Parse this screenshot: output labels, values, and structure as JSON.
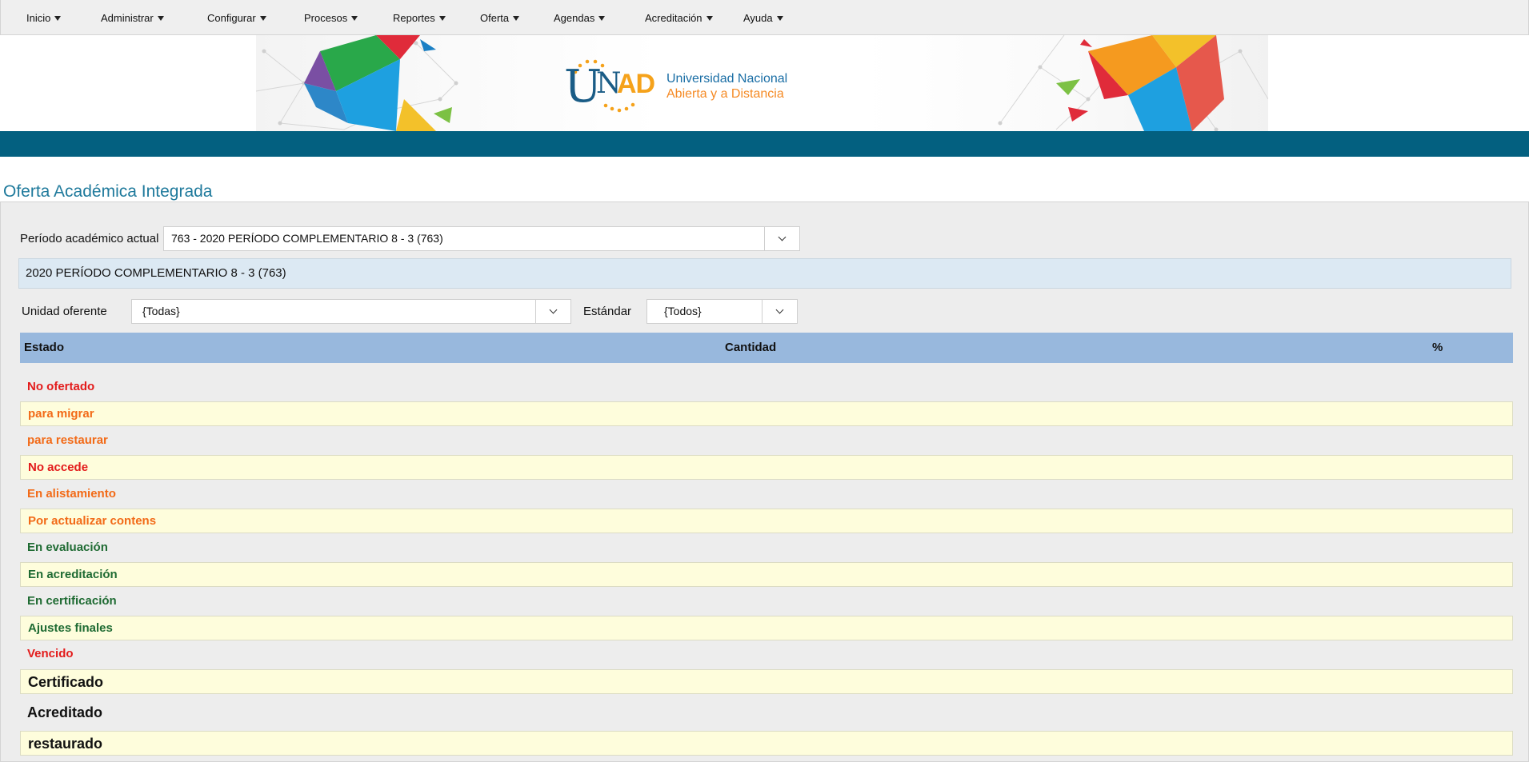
{
  "nav": {
    "items": [
      {
        "label": "Inicio"
      },
      {
        "label": "Administrar"
      },
      {
        "label": "Configurar"
      },
      {
        "label": "Procesos"
      },
      {
        "label": "Reportes"
      },
      {
        "label": "Oferta"
      },
      {
        "label": "Agendas"
      },
      {
        "label": "Acreditación"
      },
      {
        "label": "Ayuda"
      }
    ]
  },
  "banner": {
    "logo_letters_u": "U",
    "logo_letters_n": "N",
    "logo_letters_ad": "AD",
    "line1": "Universidad Nacional",
    "line2": "Abierta y a Distancia"
  },
  "page": {
    "title": "Oferta Académica Integrada"
  },
  "filters": {
    "periodo_label": "Período académico actual",
    "periodo_value": "763 - 2020 PERÍODO COMPLEMENTARIO 8 - 3 (763)",
    "periodo_info": "2020 PERÍODO COMPLEMENTARIO 8 - 3 (763)",
    "unidad_label": "Unidad oferente",
    "unidad_value": "{Todas}",
    "estandar_label": "Estándar",
    "estandar_value": "{Todos}"
  },
  "table": {
    "headers": {
      "estado": "Estado",
      "cantidad": "Cantidad",
      "pct": "%"
    },
    "rows": [
      {
        "label": "No ofertado",
        "color": "#e31b1b"
      },
      {
        "label": "para migrar",
        "color": "#f26a17"
      },
      {
        "label": "para restaurar",
        "color": "#f26a17"
      },
      {
        "label": "No accede",
        "color": "#e31b1b"
      },
      {
        "label": "En alistamiento",
        "color": "#f26a17"
      },
      {
        "label": "Por actualizar contens",
        "color": "#f26a17"
      },
      {
        "label": "En evaluación",
        "color": "#1f6b33"
      },
      {
        "label": "En acreditación",
        "color": "#1f6b33"
      },
      {
        "label": "En certificación",
        "color": "#1f6b33"
      },
      {
        "label": "Ajustes finales",
        "color": "#1f6b33"
      },
      {
        "label": "Vencido",
        "color": "#e31b1b"
      },
      {
        "label": "Certificado",
        "color": "#111111"
      },
      {
        "label": "Acreditado",
        "color": "#111111"
      },
      {
        "label": "restaurado",
        "color": "#111111"
      }
    ]
  },
  "colors": {
    "stripe": "#036080",
    "header_row": "#98b8dd",
    "info_bar": "#dce9f3",
    "striped_row": "#fefddc"
  }
}
